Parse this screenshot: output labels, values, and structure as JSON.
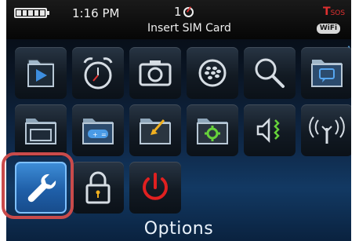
{
  "status": {
    "time": "1:16 PM",
    "notification_count": "1",
    "network_message": "Insert SIM Card",
    "signal_text": "T",
    "signal_sos": "SOS",
    "wifi_label": "WiFi"
  },
  "apps": [
    {
      "icon": "media-icon"
    },
    {
      "icon": "alarm-clock-icon"
    },
    {
      "icon": "camera-icon"
    },
    {
      "icon": "blackberry-messenger-icon"
    },
    {
      "icon": "search-icon"
    },
    {
      "icon": "messages-icon"
    },
    {
      "icon": "browser-folder-icon"
    },
    {
      "icon": "games-folder-icon"
    },
    {
      "icon": "downloads-folder-icon"
    },
    {
      "icon": "applications-folder-icon"
    },
    {
      "icon": "sound-profile-icon"
    },
    {
      "icon": "manage-connections-icon"
    },
    {
      "icon": "options-wrench-icon",
      "selected": true
    },
    {
      "icon": "lock-icon"
    },
    {
      "icon": "power-icon"
    }
  ],
  "selected_label": "Options",
  "colors": {
    "accent": "#3f8fd9",
    "highlight_border": "#c94b4b",
    "power_red": "#e02020",
    "green": "#66d23a"
  }
}
